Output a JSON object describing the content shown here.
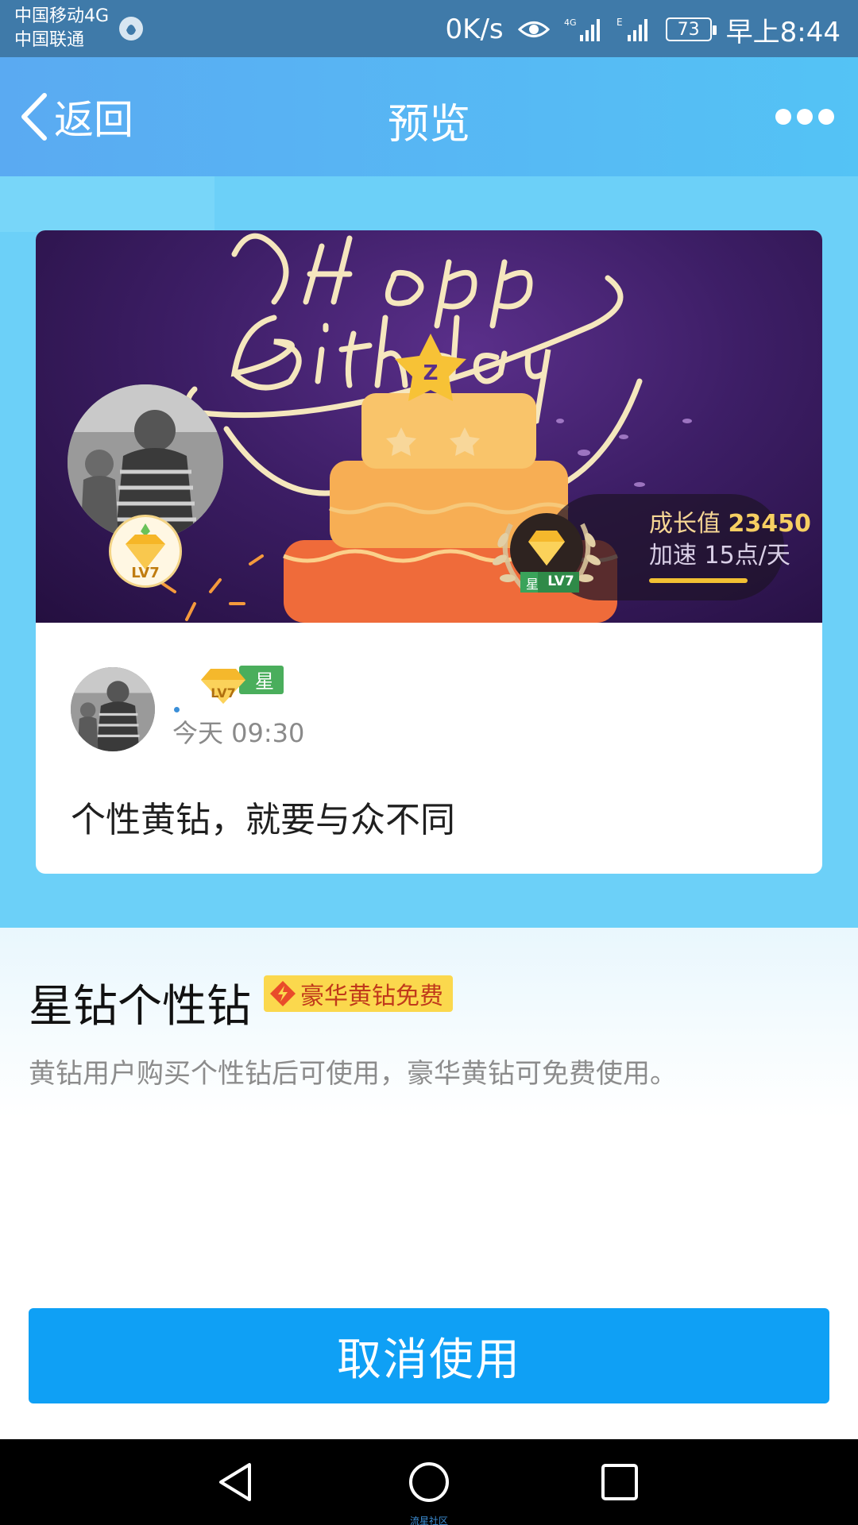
{
  "status_bar": {
    "carrier_1": "中国移动4G",
    "carrier_2": "中国联通",
    "net_speed": "0K/s",
    "battery": "73",
    "time": "早上8:44"
  },
  "nav": {
    "back_label": "返回",
    "title": "预览"
  },
  "card": {
    "banner_level": "LV7",
    "growth_label": "成长值",
    "growth_value": "23450",
    "speed_text": "加速 15点/天",
    "badge_star": "星",
    "badge_level": "LV7",
    "post_time": "今天 09:30",
    "post_text": "个性黄钻，就要与众不同"
  },
  "info": {
    "title": "星钻个性钻",
    "promo_label": "豪华黄钻免费",
    "description": "黄钻用户购买个性钻后可使用，豪华黄钻可免费使用。"
  },
  "actions": {
    "cancel_label": "取消使用"
  },
  "footer": {
    "watermark": "流星社区"
  },
  "colors": {
    "nav_start": "#5aaaf2",
    "nav_end": "#54c3f5",
    "preview_bg": "#6cd0f8",
    "button": "#0fa0f5",
    "promo": "#fbd84d"
  },
  "icons": [
    "qq-icon",
    "eye-icon",
    "signal-icon",
    "battery-icon",
    "back-chevron-icon",
    "more-icon",
    "diamond-icon",
    "bolt-icon",
    "nav-back-icon",
    "nav-home-icon",
    "nav-recent-icon"
  ]
}
